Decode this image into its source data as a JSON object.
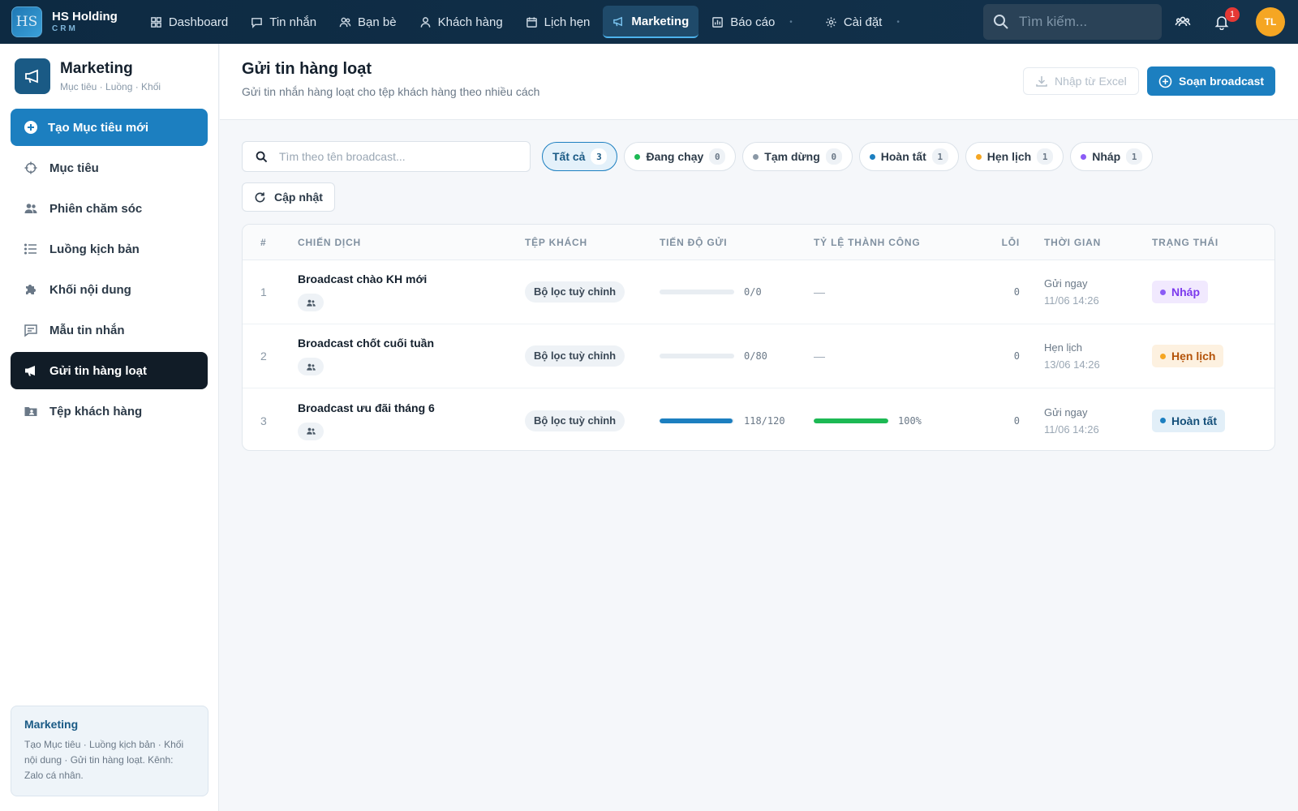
{
  "app": {
    "logo_text": "HS",
    "brand_name": "HS Holding",
    "brand_sub": "CRM"
  },
  "topnav": {
    "items": [
      {
        "label": "Dashboard",
        "icon": "grid-icon"
      },
      {
        "label": "Tin nhắn",
        "icon": "message-icon"
      },
      {
        "label": "Bạn bè",
        "icon": "friends-icon"
      },
      {
        "label": "Khách hàng",
        "icon": "user-icon"
      },
      {
        "label": "Lịch hẹn",
        "icon": "calendar-icon"
      },
      {
        "label": "Marketing",
        "icon": "megaphone-icon",
        "active": true
      },
      {
        "label": "Báo cáo",
        "icon": "chart-icon"
      },
      {
        "label": "Cài đặt",
        "icon": "gear-icon"
      }
    ],
    "search_placeholder": "Tìm kiếm...",
    "notification_count": "1",
    "avatar_initials": "TL"
  },
  "sidebar": {
    "title": "Marketing",
    "subtitle": "Mục tiêu · Luồng · Khối",
    "create_label": "Tạo Mục tiêu mới",
    "items": [
      {
        "label": "Mục tiêu",
        "icon": "crosshair-icon"
      },
      {
        "label": "Phiên chăm sóc",
        "icon": "people-icon"
      },
      {
        "label": "Luồng kịch bản",
        "icon": "list-icon"
      },
      {
        "label": "Khối nội dung",
        "icon": "puzzle-icon"
      },
      {
        "label": "Mẫu tin nhắn",
        "icon": "message-icon"
      },
      {
        "label": "Gửi tin hàng loạt",
        "icon": "megaphone-icon",
        "active": true
      },
      {
        "label": "Tệp khách hàng",
        "icon": "folder-user-icon"
      }
    ],
    "note": {
      "title": "Marketing",
      "text": "Tạo Mục tiêu · Luồng kịch bản · Khối nội dung · Gửi tin hàng loạt. Kênh: Zalo cá nhân."
    }
  },
  "page": {
    "title": "Gửi tin hàng loạt",
    "subtitle": "Gửi tin nhắn hàng loạt cho tệp khách hàng theo nhiều cách",
    "import_label": "Nhập từ Excel",
    "compose_label": "Soạn broadcast",
    "search_placeholder": "Tìm theo tên broadcast...",
    "refresh_label": "Cập nhật"
  },
  "filters": [
    {
      "label": "Tất cả",
      "count": "3",
      "active": true,
      "dot": ""
    },
    {
      "label": "Đang chạy",
      "count": "0",
      "dot": "#1db954"
    },
    {
      "label": "Tạm dừng",
      "count": "0",
      "dot": "#8a98a6"
    },
    {
      "label": "Hoàn tất",
      "count": "1",
      "dot": "#1c7fc0"
    },
    {
      "label": "Hẹn lịch",
      "count": "1",
      "dot": "#f5a623"
    },
    {
      "label": "Nháp",
      "count": "1",
      "dot": "#8b5cf6"
    }
  ],
  "table": {
    "headers": {
      "idx": "#",
      "name": "CHIẾN DỊCH",
      "segment": "TỆP KHÁCH",
      "progress": "TIẾN ĐỘ GỬI",
      "rate": "TỶ LỆ THÀNH CÔNG",
      "errors": "LỖI",
      "time": "THỜI GIAN",
      "status": "TRẠNG THÁI"
    },
    "rows": [
      {
        "idx": "1",
        "name": "Broadcast chào KH mới",
        "segment": "Bộ lọc tuỳ chỉnh",
        "progress_text": "0/0",
        "progress": 0,
        "rate_text": "—",
        "rate": null,
        "errors": "0",
        "time_label": "Gửi ngay",
        "time_value": "11/06 14:26",
        "status": "Nháp",
        "status_color": "#7c3aed",
        "status_bg": "#f1e9fe",
        "status_dot": "#8b5cf6"
      },
      {
        "idx": "2",
        "name": "Broadcast chốt cuối tuần",
        "segment": "Bộ lọc tuỳ chỉnh",
        "progress_text": "0/80",
        "progress": 0,
        "rate_text": "—",
        "rate": null,
        "errors": "0",
        "time_label": "Hẹn lịch",
        "time_value": "13/06 14:26",
        "status": "Hẹn lịch",
        "status_color": "#b45309",
        "status_bg": "#fdf1e0",
        "status_dot": "#f5a623"
      },
      {
        "idx": "3",
        "name": "Broadcast ưu đãi tháng 6",
        "segment": "Bộ lọc tuỳ chỉnh",
        "progress_text": "118/120",
        "progress": 0.983,
        "rate_text": "100%",
        "rate": 1.0,
        "errors": "0",
        "time_label": "Gửi ngay",
        "time_value": "11/06 14:26",
        "status": "Hoàn tất",
        "status_color": "#15507a",
        "status_bg": "#e2eff8",
        "status_dot": "#1c7fc0"
      }
    ]
  },
  "colors": {
    "accent": "#1c7fc0",
    "nav_bg": "#0d2a42",
    "success": "#1db954"
  }
}
